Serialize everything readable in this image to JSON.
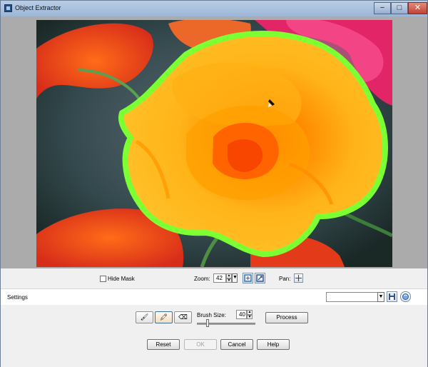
{
  "window": {
    "title": "Object Extractor",
    "controls": {
      "minimize": "−",
      "maximize": "□",
      "close": "✕"
    }
  },
  "canvas": {
    "image": "rose-photo",
    "mask_color": "#7cff33"
  },
  "toolbar": {
    "hide_mask_label": "Hide Mask",
    "hide_mask_checked": false,
    "zoom_label": "Zoom:",
    "zoom_value": "42",
    "pan_label": "Pan:",
    "zoom_fit_icon": "fit-to-window-icon",
    "zoom_actual_icon": "actual-size-icon",
    "pan_icon": "crosshair-icon"
  },
  "settings": {
    "label": "Settings",
    "selected_value": "",
    "save_icon": "floppy-disk-icon",
    "reset_icon": "refresh-icon"
  },
  "tools": {
    "items": [
      {
        "name": "brush-tool",
        "glyph": "🖌"
      },
      {
        "name": "fill-tool",
        "glyph": "🖍"
      },
      {
        "name": "eraser-tool",
        "glyph": "⌫"
      }
    ],
    "brush_size_label": "Brush Size:",
    "brush_size_value": "40",
    "brush_size_fraction": 0.2,
    "process_label": "Process"
  },
  "footer": {
    "reset": "Reset",
    "ok": "OK",
    "cancel": "Cancel",
    "help": "Help"
  },
  "colors": {
    "petal": "#ffb21a",
    "petal_center": "#ff6a00",
    "mask": "#7cff33",
    "background_red": "#e5391f",
    "background_pink": "#e0206a"
  }
}
